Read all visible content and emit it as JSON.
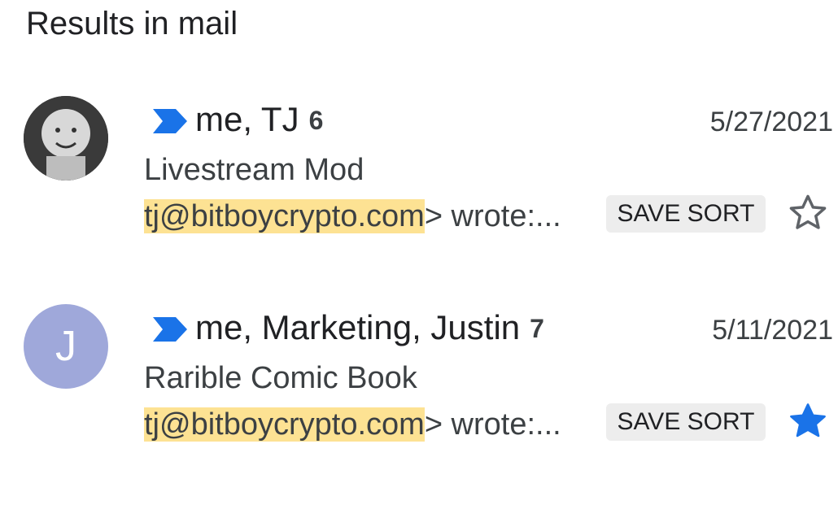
{
  "section_title": "Results in mail",
  "threads": [
    {
      "senders": "me, TJ",
      "count": "6",
      "date": "5/27/2021",
      "subject": "Livestream Mod",
      "snippet_highlight": "tj@bitboycrypto.com",
      "snippet_rest": "> wrote:...",
      "label": "SAVE SORT",
      "starred": false,
      "avatar": "photo",
      "avatar_letter": ""
    },
    {
      "senders": "me, Marketing, Justin",
      "count": "7",
      "date": "5/11/2021",
      "subject": "Rarible Comic Book",
      "snippet_highlight": "tj@bitboycrypto.com",
      "snippet_rest": "> wrote:...",
      "label": "SAVE SORT",
      "starred": true,
      "avatar": "letter",
      "avatar_letter": "J"
    }
  ],
  "colors": {
    "importance_marker": "#1a73e8",
    "star_filled": "#1a73e8",
    "star_outline": "#5f6368",
    "highlight": "#fde293",
    "letter_avatar": "#9fa8da",
    "label_chip": "#ededed"
  },
  "icons": {
    "importance": "importance-marker-icon",
    "star_empty": "star-outline-icon",
    "star_filled": "star-filled-icon"
  }
}
